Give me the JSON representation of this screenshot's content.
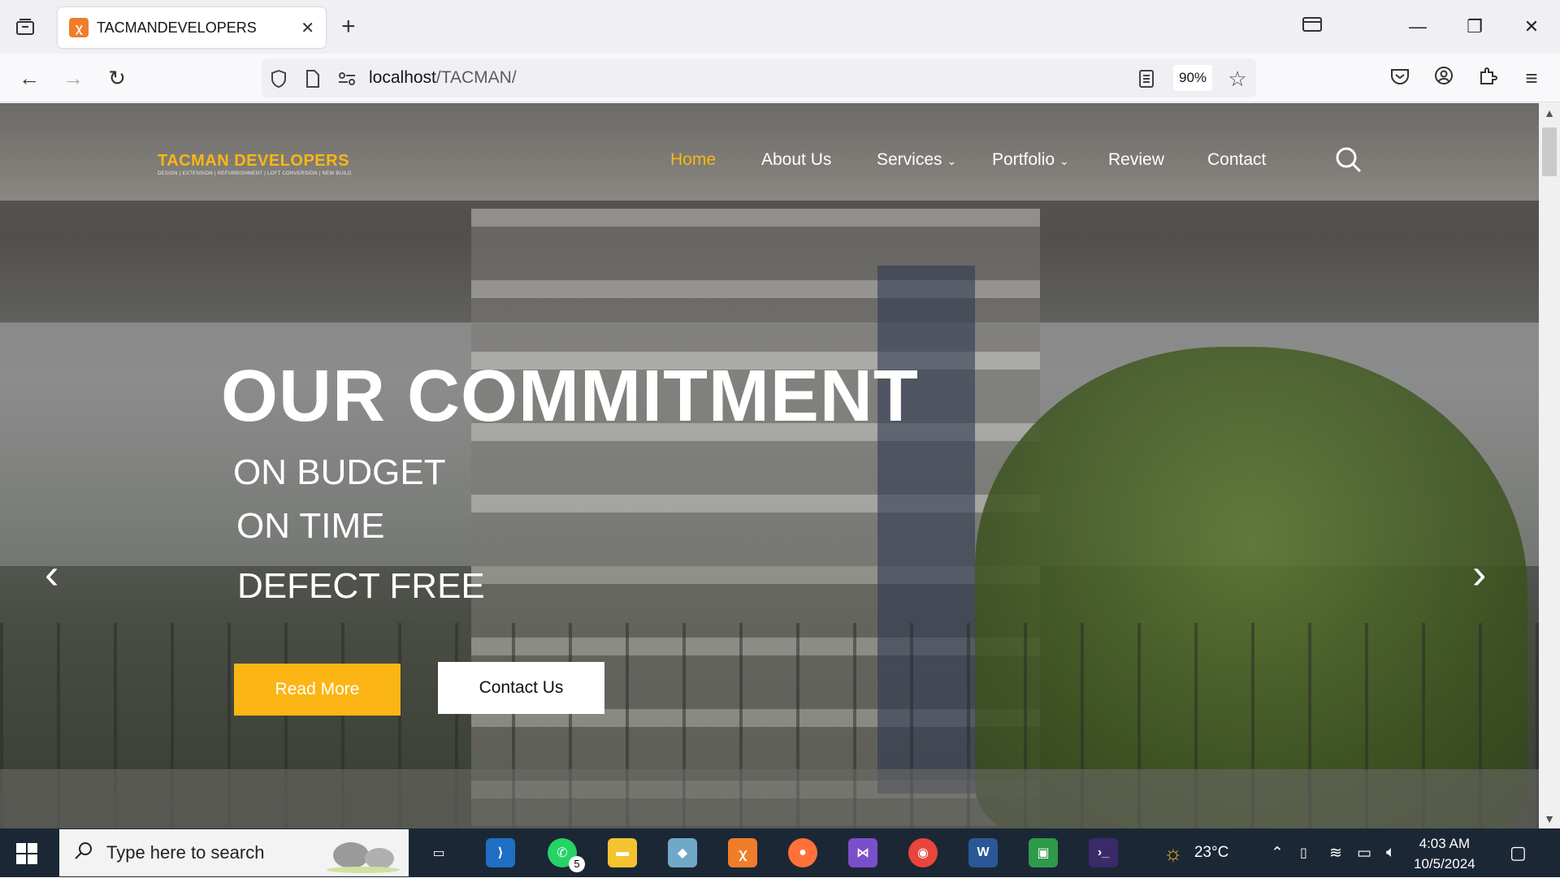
{
  "browser": {
    "tab_title": "TACMANDEVELOPERS",
    "url_host": "localhost",
    "url_path": "/TACMAN/",
    "zoom": "90%"
  },
  "site": {
    "logo_name": "TACMAN DEVELOPERS",
    "logo_tagline": "DESIGN | EXTENSION | REFURBISHMENT | LOFT CONVERSION | NEW BUILD",
    "menu": {
      "home": "Home",
      "about": "About Us",
      "services": "Services",
      "portfolio": "Portfolio",
      "review": "Review",
      "contact": "Contact"
    },
    "hero": {
      "headline": "OUR COMMITMENT",
      "line1": "ON BUDGET",
      "line2": "ON TIME",
      "line3": "DEFECT FREE",
      "read_more": "Read More",
      "contact_us": "Contact Us"
    },
    "accent_color": "#fbb615"
  },
  "taskbar": {
    "search_placeholder": "Type here to search",
    "whatsapp_badge": "5",
    "temperature": "23°C",
    "time": "4:03 AM",
    "date": "10/5/2024"
  }
}
